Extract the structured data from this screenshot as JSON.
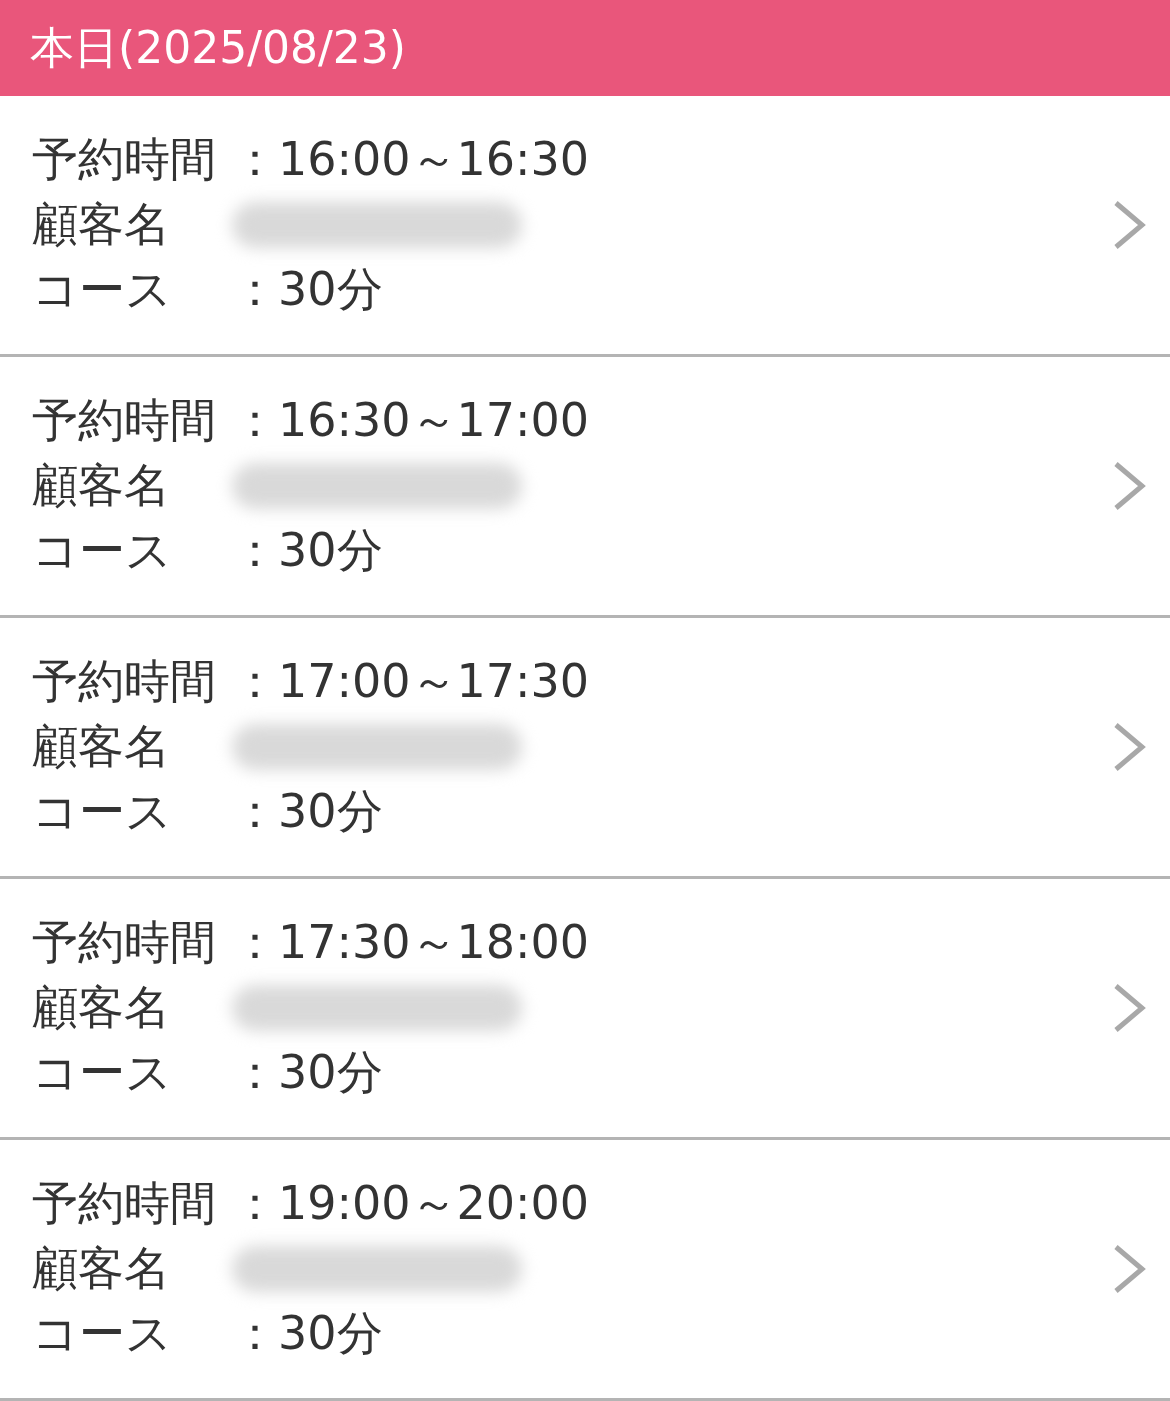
{
  "header": {
    "title": "本日(2025/08/23)"
  },
  "reservations": [
    {
      "time_label": "予約時間",
      "time": "：16:00～16:30",
      "name_label": "顧客名",
      "course_label": "コース",
      "course": "：30分"
    },
    {
      "time_label": "予約時間",
      "time": "：16:30～17:00",
      "name_label": "顧客名",
      "course_label": "コース",
      "course": "：30分"
    },
    {
      "time_label": "予約時間",
      "time": "：17:00～17:30",
      "name_label": "顧客名",
      "course_label": "コース",
      "course": "：30分"
    },
    {
      "time_label": "予約時間",
      "time": "：17:30～18:00",
      "name_label": "顧客名",
      "course_label": "コース",
      "course": "：30分"
    },
    {
      "time_label": "予約時間",
      "time": "：19:00～20:00",
      "name_label": "顧客名",
      "course_label": "コース",
      "course": "：30分"
    }
  ]
}
